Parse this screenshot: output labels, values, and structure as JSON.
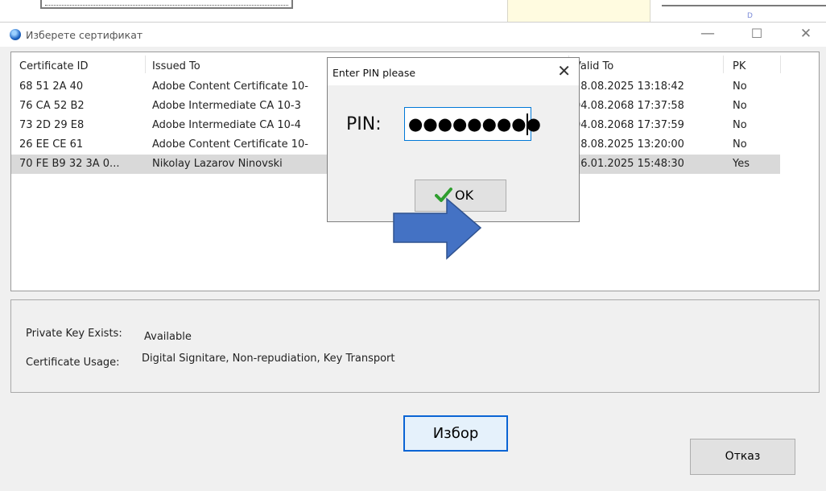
{
  "window": {
    "title": "Изберете сертификат",
    "controls": {
      "minimize": "—",
      "maximize": "☐",
      "close": "✕"
    }
  },
  "table": {
    "columns": [
      "Certificate ID",
      "Issued To",
      "Valid To",
      "PK"
    ],
    "rows": [
      {
        "id": "68 51 2A 40",
        "issued_to": "Adobe Content Certificate 10-",
        "valid_to": "18.08.2025 13:18:42",
        "pk": "No"
      },
      {
        "id": "76 CA 52 B2",
        "issued_to": "Adobe Intermediate CA 10-3",
        "valid_to": "04.08.2068 17:37:58",
        "pk": "No"
      },
      {
        "id": "73 2D 29 E8",
        "issued_to": "Adobe Intermediate CA 10-4",
        "valid_to": "04.08.2068 17:37:59",
        "pk": "No"
      },
      {
        "id": "26 EE CE 61",
        "issued_to": "Adobe Content Certificate 10-",
        "valid_to": "18.08.2025 13:20:00",
        "pk": "No"
      },
      {
        "id": "70 FE B9 32 3A 0...",
        "issued_to": "Nikolay Lazarov Ninovski",
        "valid_to": "16.01.2025 15:48:30",
        "pk": "Yes",
        "selected": true
      }
    ]
  },
  "details": {
    "private_key_label": "Private Key Exists:",
    "private_key_value": "Available",
    "usage_label": "Certificate Usage:",
    "usage_value": "Digital Signitare, Non-repudiation, Key Transport"
  },
  "buttons": {
    "select": "Избор",
    "cancel": "Отказ"
  },
  "pin_dialog": {
    "title": "Enter PIN please",
    "pin_label": "PIN:",
    "pin_masked": "●●●●●●●●●",
    "ok_label": "OK"
  },
  "colors": {
    "accent": "#0078d7",
    "arrow": "#4472c4",
    "selected_row": "#d9d9d9",
    "check": "#2e9e2e"
  },
  "icons": [
    "app-icon",
    "minimize-icon",
    "maximize-icon",
    "close-icon",
    "check-icon",
    "arrow-annotation"
  ]
}
